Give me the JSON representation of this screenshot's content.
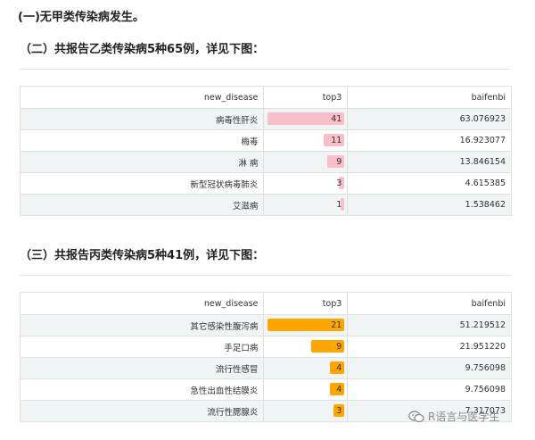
{
  "headings": {
    "h1": "(一)无甲类传染病发生。",
    "h2": "（二）共报告乙类传染病5种65例，详见下图：",
    "h3": "（三）共报告丙类传染病5种41例，详见下图："
  },
  "colors": {
    "bar_b": "#f8bfc9",
    "bar_c": "#ffa500"
  },
  "table_b": {
    "headers": [
      "new_disease",
      "top3",
      "baifenbi"
    ],
    "rows": [
      {
        "disease": "病毒性肝炎",
        "top3": 41,
        "baifenbi": "63.076923"
      },
      {
        "disease": "梅毒",
        "top3": 11,
        "baifenbi": "16.923077"
      },
      {
        "disease": "淋 病",
        "top3": 9,
        "baifenbi": "13.846154"
      },
      {
        "disease": "新型冠状病毒肺炎",
        "top3": 3,
        "baifenbi": "4.615385"
      },
      {
        "disease": "艾滋病",
        "top3": 1,
        "baifenbi": "1.538462"
      }
    ],
    "max": 41
  },
  "table_c": {
    "headers": [
      "new_disease",
      "top3",
      "baifenbi"
    ],
    "rows": [
      {
        "disease": "其它感染性腹泻病",
        "top3": 21,
        "baifenbi": "51.219512"
      },
      {
        "disease": "手足口病",
        "top3": 9,
        "baifenbi": "21.951220"
      },
      {
        "disease": "流行性感冒",
        "top3": 4,
        "baifenbi": "9.756098"
      },
      {
        "disease": "急性出血性结膜炎",
        "top3": 4,
        "baifenbi": "9.756098"
      },
      {
        "disease": "流行性腮腺炎",
        "top3": 3,
        "baifenbi": "7.317073"
      }
    ],
    "max": 21
  },
  "watermark": {
    "icon": "wechat-icon",
    "text": "R语言与医学生"
  }
}
